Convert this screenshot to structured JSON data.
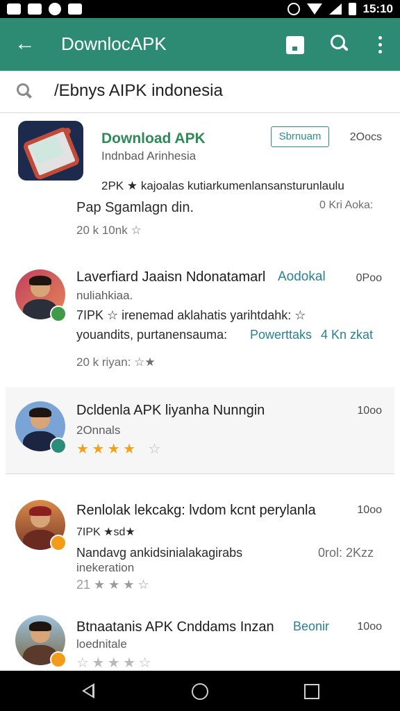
{
  "status_bar": {
    "time": "15:10"
  },
  "app_bar": {
    "title": "DownlocAPK",
    "back_icon": "arrow-left-icon",
    "actions": [
      "bookmark-icon",
      "search-icon",
      "more-vert-icon"
    ]
  },
  "search": {
    "query": "/Ebnys AIPK indonesia"
  },
  "items": [
    {
      "title": "Download APK",
      "subtitle": "Indnbad Arinhesia",
      "button": "Sbrnuam",
      "count": "2Oocs",
      "line1": "2PK ★ kajoalas kutiarkumenlansansturunlaulu",
      "line2": "Pap Sgamlagn din.",
      "line2_right": "0 Kri Aoka:",
      "meta": "20 k 10nk ☆"
    },
    {
      "title": "Laverfiard Jaaisn Ndonatamarl",
      "title_right": "Aodokal",
      "count": "0Poo",
      "subtitle": "nuliahkiaa.",
      "line1": "7IPK ☆ irenemad aklahatis yarihtdahk: ☆",
      "line2": "youandits, purtanensauma:",
      "line2_teal": "Powerttaks",
      "line2_right": "4 Kn zkat",
      "meta": "20 k riyan: ☆★"
    },
    {
      "title": "Dcldenla APK liyanha Nunngin",
      "count": "10oo",
      "subtitle": "2Onnals",
      "stars": 4
    },
    {
      "title": "Renlolak lekcakg: lvdom kcnt perylanla",
      "count": "10oo",
      "line1": "7IPK ★sd★",
      "line2": "Nandavg ankidsinialakagirabs",
      "line2_right": "0rol: 2Kzz",
      "subtitle": "inekeration",
      "meta": "21 ★ ★ ★ ☆"
    },
    {
      "title": "Btnaatanis APK Cnddams Inzan",
      "title_right": "Beonir",
      "count": "10oo",
      "subtitle": "loednitale"
    }
  ],
  "colors": {
    "appbar": "#2d8a73",
    "teal_text": "#2a7f93",
    "star": "#f1a21c"
  }
}
